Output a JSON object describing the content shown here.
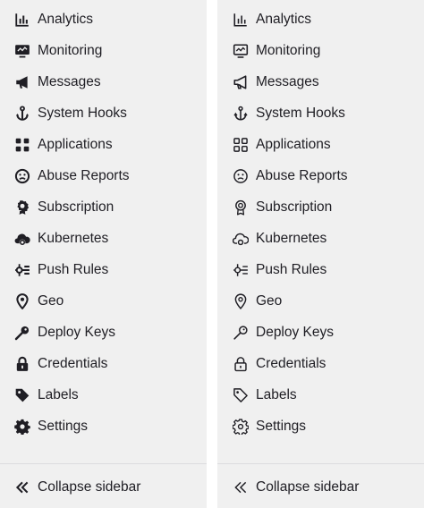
{
  "colors": {
    "panel_bg": "#f0f0f0",
    "text": "#1f1e24",
    "divider": "#dcdcde",
    "page_bg": "#ffffff"
  },
  "panels": [
    {
      "variant": "filled-icons",
      "items": [
        {
          "label": "Analytics",
          "icon": "chart-bar-icon"
        },
        {
          "label": "Monitoring",
          "icon": "monitor-icon"
        },
        {
          "label": "Messages",
          "icon": "megaphone-icon"
        },
        {
          "label": "System Hooks",
          "icon": "anchor-icon"
        },
        {
          "label": "Applications",
          "icon": "applications-grid-icon"
        },
        {
          "label": "Abuse Reports",
          "icon": "sad-face-icon"
        },
        {
          "label": "Subscription",
          "icon": "ribbon-badge-icon"
        },
        {
          "label": "Kubernetes",
          "icon": "cloud-gear-icon"
        },
        {
          "label": "Push Rules",
          "icon": "push-rules-icon"
        },
        {
          "label": "Geo",
          "icon": "location-pin-icon"
        },
        {
          "label": "Deploy Keys",
          "icon": "key-icon"
        },
        {
          "label": "Credentials",
          "icon": "lock-icon"
        },
        {
          "label": "Labels",
          "icon": "tag-icon"
        },
        {
          "label": "Settings",
          "icon": "gear-icon"
        }
      ],
      "collapse_label": "Collapse sidebar"
    },
    {
      "variant": "outline-icons",
      "items": [
        {
          "label": "Analytics",
          "icon": "chart-bar-icon"
        },
        {
          "label": "Monitoring",
          "icon": "monitor-icon"
        },
        {
          "label": "Messages",
          "icon": "megaphone-icon"
        },
        {
          "label": "System Hooks",
          "icon": "anchor-icon"
        },
        {
          "label": "Applications",
          "icon": "applications-grid-icon"
        },
        {
          "label": "Abuse Reports",
          "icon": "sad-face-icon"
        },
        {
          "label": "Subscription",
          "icon": "ribbon-badge-icon"
        },
        {
          "label": "Kubernetes",
          "icon": "cloud-gear-icon"
        },
        {
          "label": "Push Rules",
          "icon": "push-rules-icon"
        },
        {
          "label": "Geo",
          "icon": "location-pin-icon"
        },
        {
          "label": "Deploy Keys",
          "icon": "key-icon"
        },
        {
          "label": "Credentials",
          "icon": "lock-icon"
        },
        {
          "label": "Labels",
          "icon": "tag-icon"
        },
        {
          "label": "Settings",
          "icon": "gear-icon"
        }
      ],
      "collapse_label": "Collapse sidebar"
    }
  ]
}
